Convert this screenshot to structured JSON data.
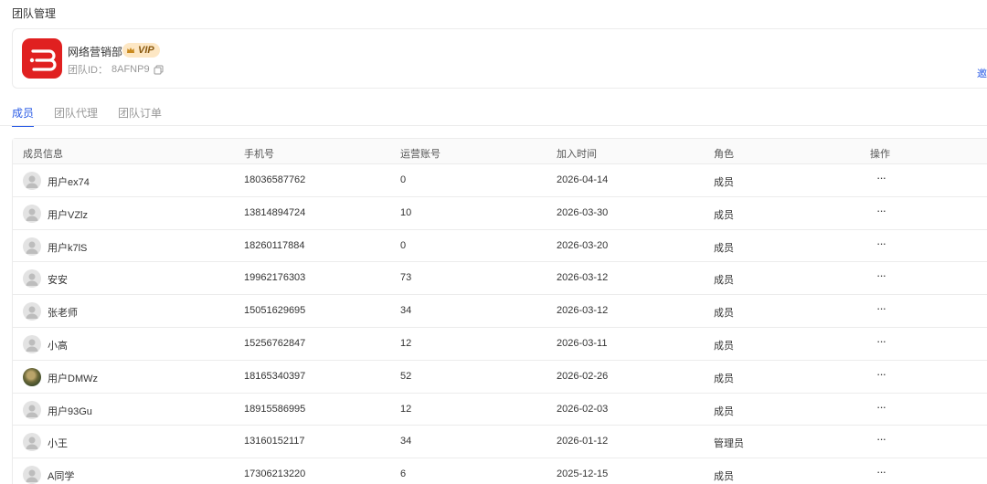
{
  "page": {
    "title": "团队管理"
  },
  "team": {
    "name": "网络营销部",
    "vip_label": "VIP",
    "id_label": "团队ID：",
    "id_value": "8AFNP9",
    "invite_text": "邀",
    "logo_color": "#e02020",
    "icons": {
      "logo": "team-logo-icon",
      "crown": "crown-icon",
      "copy": "copy-icon"
    }
  },
  "tabs": [
    {
      "label": "成员",
      "active": true
    },
    {
      "label": "团队代理",
      "active": false
    },
    {
      "label": "团队订单",
      "active": false
    }
  ],
  "table": {
    "headers": [
      "成员信息",
      "手机号",
      "运营账号",
      "加入时间",
      "角色",
      "操作"
    ],
    "rows": [
      {
        "name": "用户ex74",
        "phone": "18036587762",
        "accounts": "0",
        "joined": "2026-04-14",
        "role": "成员",
        "action": "···",
        "avatar": "default"
      },
      {
        "name": "用户VZlz",
        "phone": "13814894724",
        "accounts": "10",
        "joined": "2026-03-30",
        "role": "成员",
        "action": "···",
        "avatar": "default"
      },
      {
        "name": "用户k7lS",
        "phone": "18260117884",
        "accounts": "0",
        "joined": "2026-03-20",
        "role": "成员",
        "action": "···",
        "avatar": "default"
      },
      {
        "name": "安安",
        "phone": "19962176303",
        "accounts": "73",
        "joined": "2026-03-12",
        "role": "成员",
        "action": "···",
        "avatar": "default"
      },
      {
        "name": "张老师",
        "phone": "15051629695",
        "accounts": "34",
        "joined": "2026-03-12",
        "role": "成员",
        "action": "···",
        "avatar": "default"
      },
      {
        "name": "小高",
        "phone": "15256762847",
        "accounts": "12",
        "joined": "2026-03-11",
        "role": "成员",
        "action": "···",
        "avatar": "default"
      },
      {
        "name": "用户DMWz",
        "phone": "18165340397",
        "accounts": "52",
        "joined": "2026-02-26",
        "role": "成员",
        "action": "···",
        "avatar": "photo"
      },
      {
        "name": "用户93Gu",
        "phone": "18915586995",
        "accounts": "12",
        "joined": "2026-02-03",
        "role": "成员",
        "action": "···",
        "avatar": "default"
      },
      {
        "name": "小王",
        "phone": "13160152117",
        "accounts": "34",
        "joined": "2026-01-12",
        "role": "管理员",
        "action": "···",
        "avatar": "default"
      },
      {
        "name": "A同学",
        "phone": "17306213220",
        "accounts": "6",
        "joined": "2025-12-15",
        "role": "成员",
        "action": "···",
        "avatar": "default"
      }
    ]
  },
  "colors": {
    "accent": "#2b5ce6",
    "vip_bg": "#fde7c4",
    "border": "#ececec"
  }
}
